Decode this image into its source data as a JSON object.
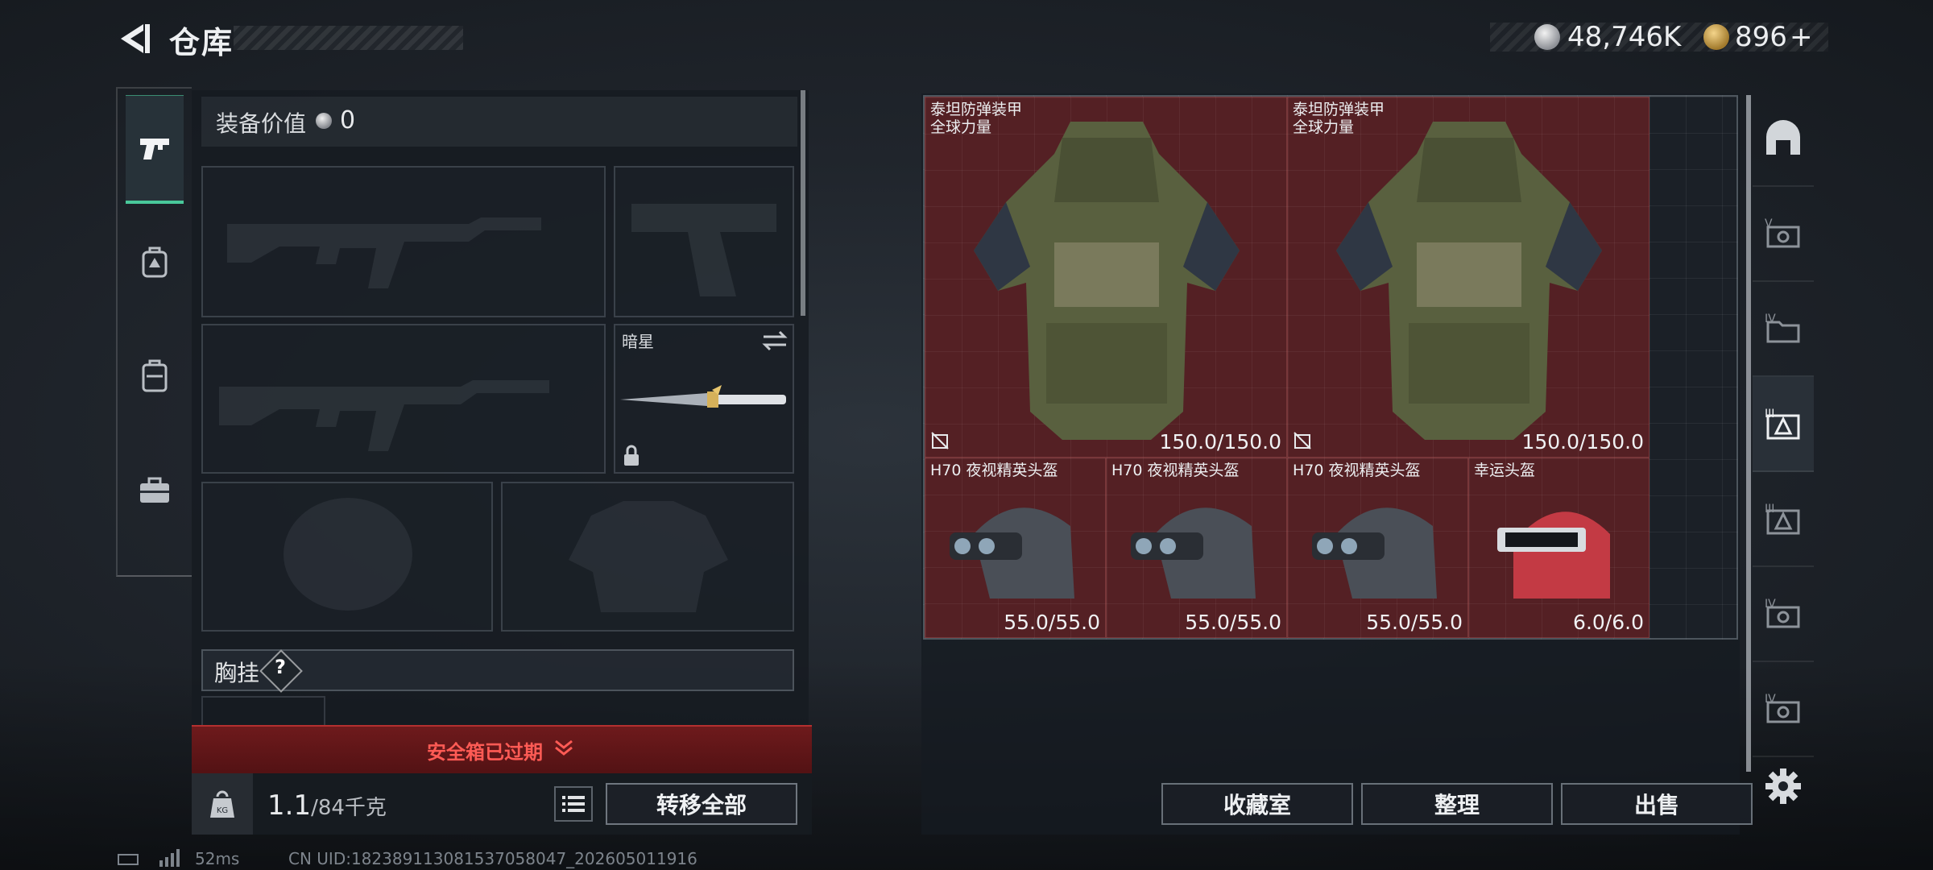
{
  "header": {
    "title": "仓库",
    "silver_amount": "48,746K",
    "gold_amount": "896",
    "add_symbol": "+"
  },
  "loadout": {
    "value_label": "装备价值",
    "value_amount": "0",
    "knife_label": "暗星",
    "chest_label": "胸挂",
    "help_symbol": "?",
    "expired_text": "安全箱已过期",
    "weight_current": "1.1",
    "weight_capacity": "/84千克",
    "transfer_all": "转移全部"
  },
  "inventory": {
    "items": [
      {
        "name": "泰坦防弹装甲",
        "sub": "全球力量",
        "durability": "150.0/150.0"
      },
      {
        "name": "泰坦防弹装甲",
        "sub": "全球力量",
        "durability": "150.0/150.0"
      },
      {
        "name": "H70 夜视精英头盔",
        "durability": "55.0/55.0"
      },
      {
        "name": "H70 夜视精英头盔",
        "durability": "55.0/55.0"
      },
      {
        "name": "H70 夜视精英头盔",
        "durability": "55.0/55.0"
      },
      {
        "name": "幸运头盔",
        "durability": "6.0/6.0"
      }
    ],
    "buttons": {
      "collection": "收藏室",
      "organize": "整理",
      "sell": "出售"
    }
  },
  "categories": [
    "armor-all",
    "V",
    "IV",
    "III",
    "III",
    "IV",
    "IV"
  ],
  "status": {
    "ping": "52ms",
    "uid": "CN UID:18238911308153705804​7_202605011916"
  },
  "colors": {
    "accent": "#49c89a",
    "item_bg": "#542024",
    "expired": "#ff5b55"
  }
}
